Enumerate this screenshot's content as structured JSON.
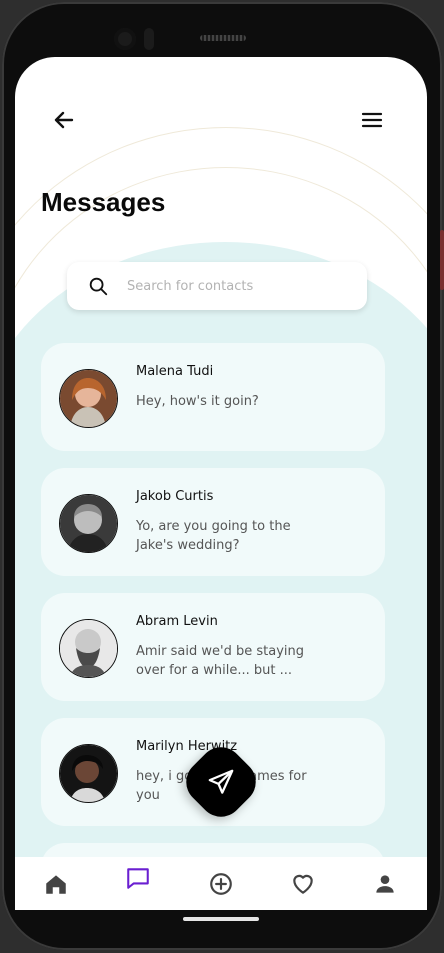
{
  "header": {
    "title": "Messages",
    "back_icon": "arrow-left-icon",
    "menu_icon": "hamburger-menu-icon"
  },
  "search": {
    "placeholder": "Search for contacts",
    "icon": "search-icon"
  },
  "conversations": [
    {
      "name": "Malena Tudi",
      "preview": "Hey, how's it goin?"
    },
    {
      "name": "Jakob Curtis",
      "preview": "Yo, are you going to the Jake's wedding?"
    },
    {
      "name": "Abram Levin",
      "preview": "Amir said we'd be staying over for a while... but ..."
    },
    {
      "name": "Marilyn Herwitz",
      "preview": "hey, i got some games for you"
    }
  ],
  "fab": {
    "icon": "send-icon"
  },
  "bottom_nav": [
    {
      "icon": "home-icon",
      "active": false
    },
    {
      "icon": "chat-icon",
      "active": true
    },
    {
      "icon": "add-circle-icon",
      "active": false
    },
    {
      "icon": "heart-icon",
      "active": false
    },
    {
      "icon": "profile-icon",
      "active": false
    }
  ],
  "colors": {
    "accent": "#6a1fd1",
    "card_bg": "#f1fafa",
    "teal_bg": "#e0f3f3"
  }
}
